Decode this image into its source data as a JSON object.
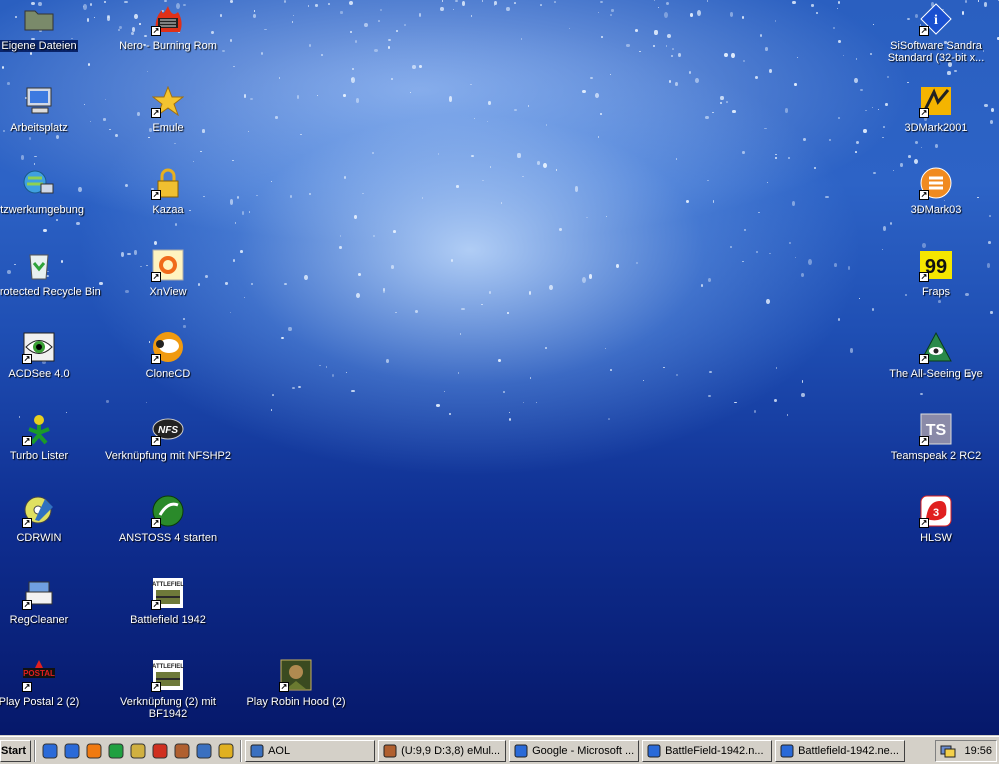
{
  "desktop": {
    "icons_left": [
      {
        "label": "Eigene Dateien",
        "icon": "folder-icon",
        "selected": true
      },
      {
        "label": "Arbeitsplatz",
        "icon": "computer-icon"
      },
      {
        "label": "etzwerkumgebung",
        "icon": "network-icon"
      },
      {
        "label": "on Protected Recycle Bin",
        "icon": "recycle-bin-icon"
      },
      {
        "label": "ACDSee 4.0",
        "icon": "eye-icon"
      },
      {
        "label": "Turbo Lister",
        "icon": "green-figure-icon"
      },
      {
        "label": "CDRWIN",
        "icon": "cd-icon"
      },
      {
        "label": "RegCleaner",
        "icon": "registry-icon"
      },
      {
        "label": "Play Postal 2 (2)",
        "icon": "postal-icon"
      }
    ],
    "icons_mid": [
      {
        "label": "Nero - Burning Rom",
        "icon": "nero-fire-icon"
      },
      {
        "label": "Emule",
        "icon": "star-icon"
      },
      {
        "label": "Kazaa",
        "icon": "lock-icon"
      },
      {
        "label": "XnView",
        "icon": "xnview-icon"
      },
      {
        "label": "CloneCD",
        "icon": "sheep-icon"
      },
      {
        "label": "Verknüpfung mit NFSHP2",
        "icon": "nfs-icon"
      },
      {
        "label": "ANSTOSS 4 starten",
        "icon": "anstoss-icon"
      },
      {
        "label": "Battlefield 1942",
        "icon": "battlefield-icon"
      },
      {
        "label": "Verknüpfung (2) mit BF1942",
        "icon": "battlefield-icon"
      }
    ],
    "icons_third": [
      {
        "label": "Play Robin Hood (2)",
        "icon": "robin-hood-icon"
      }
    ],
    "icons_right": [
      {
        "label": "SiSoftware Sandra Standard (32-bit x...",
        "icon": "info-diamond-icon"
      },
      {
        "label": "3DMark2001",
        "icon": "3dmark2001-icon"
      },
      {
        "label": "3DMark03",
        "icon": "3dmark03-icon"
      },
      {
        "label": "Fraps",
        "icon": "fraps-icon"
      },
      {
        "label": "The All-Seeing Eye",
        "icon": "all-seeing-eye-icon"
      },
      {
        "label": "Teamspeak 2 RC2",
        "icon": "teamspeak-icon"
      },
      {
        "label": "HLSW",
        "icon": "hlsw-icon"
      }
    ]
  },
  "taskbar": {
    "start_label": "Start",
    "quick_launch": [
      "ie-icon",
      "ie-icon",
      "media-player-icon",
      "winamp-icon",
      "folder-icon",
      "nero-icon",
      "emule-icon",
      "aol-icon",
      "clonecd-icon"
    ],
    "tasks": [
      {
        "label": "AOL",
        "icon": "aol-icon"
      },
      {
        "label": "(U:9,9 D:3,8) eMul...",
        "icon": "emule-icon"
      },
      {
        "label": "Google - Microsoft ...",
        "icon": "ie-icon"
      },
      {
        "label": "BattleField-1942.n...",
        "icon": "ie-icon"
      },
      {
        "label": "Battlefield-1942.ne...",
        "icon": "ie-icon"
      }
    ],
    "clock": "19:56"
  }
}
